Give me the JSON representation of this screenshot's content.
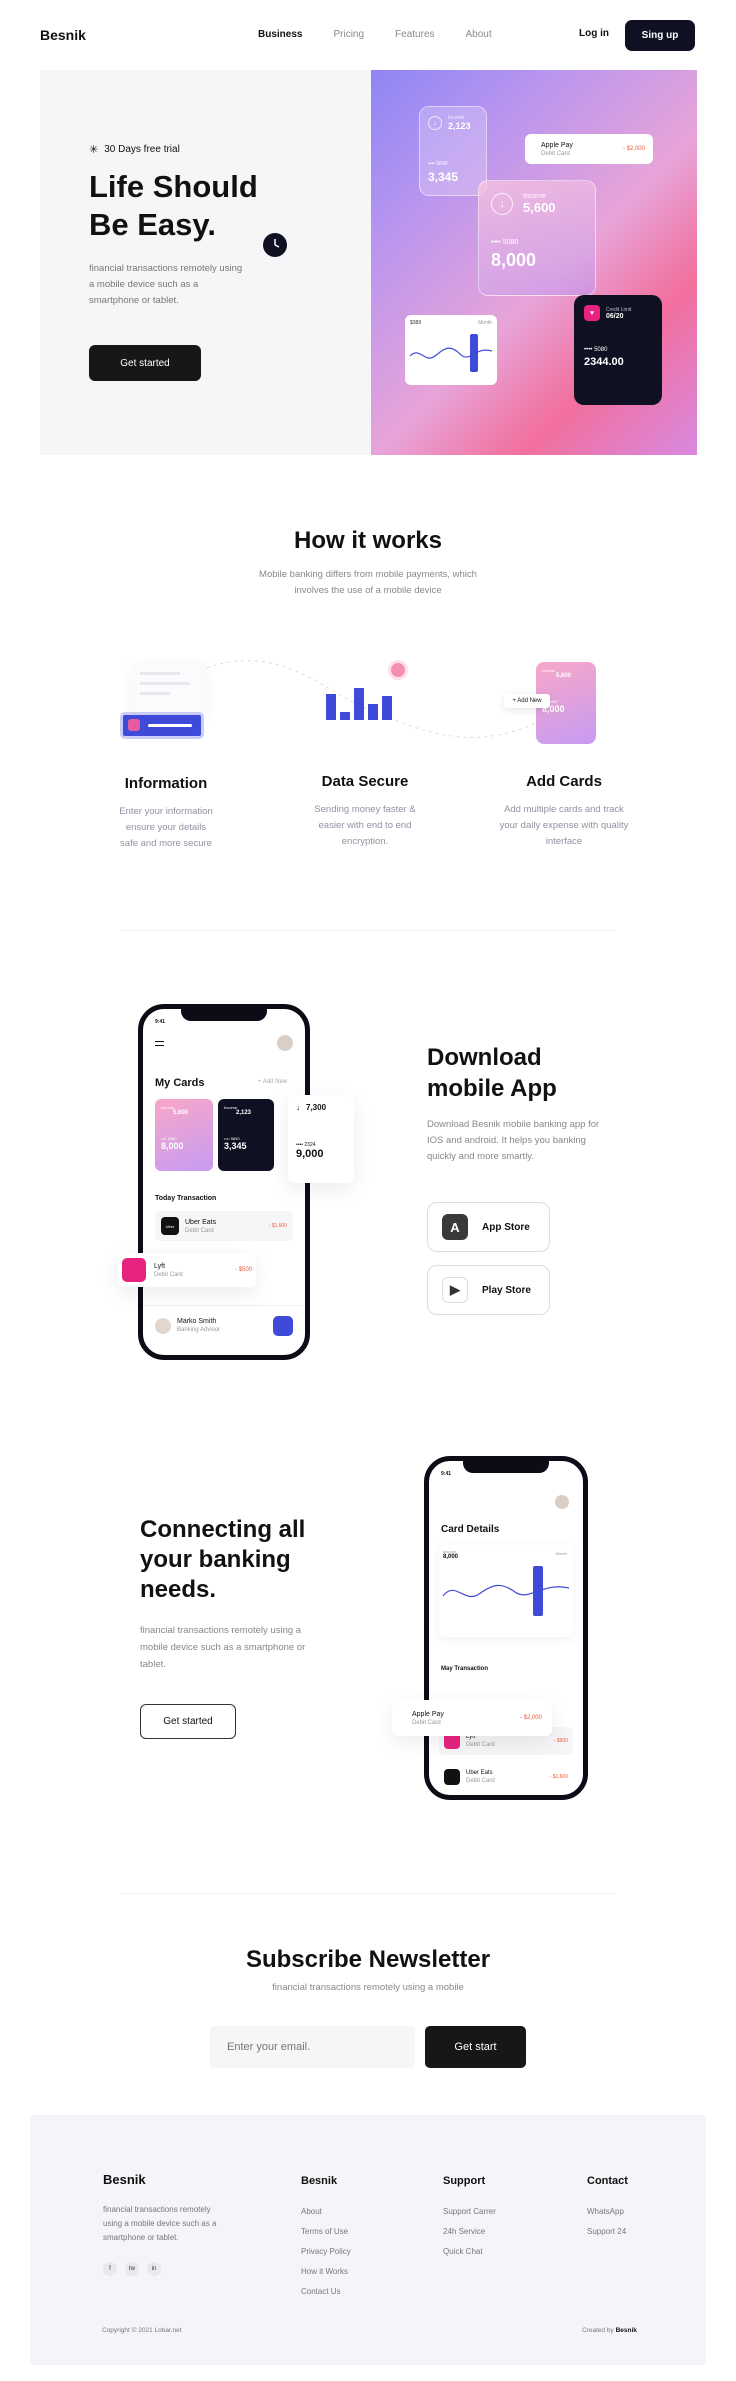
{
  "nav": {
    "logo": "Besnik",
    "links": [
      "Business",
      "Pricing",
      "Features",
      "About"
    ],
    "login": "Log in",
    "signup": "Sing up"
  },
  "hero": {
    "trial": "30 Days free trial",
    "title": "Life Should Be Easy.",
    "text": "financial transactions remotely using a mobile device such as a smartphone or tablet.",
    "cta": "Get started",
    "cards": {
      "income1_label": "Income",
      "income1_value": "2,123",
      "income1_num": "5840",
      "income1_total": "3,345",
      "income2_label": "Income",
      "income2_value": "5,600",
      "income2_num": "5080",
      "income2_total": "8,000",
      "apple_title": "Apple Pay",
      "apple_sub": "Debit Card",
      "apple_amount": "- $2,000",
      "dark_label": "Credit Limit",
      "dark_date": "06/20",
      "dark_num": "5080",
      "dark_total": "2344.00",
      "chart_value": "$389",
      "chart_month": "Month"
    }
  },
  "how": {
    "title": "How it works",
    "subtitle": "Mobile banking differs from mobile payments, which involves the use of a mobile device",
    "features": [
      {
        "title": "Information",
        "text": "Enter your information ensure your details safe and more secure"
      },
      {
        "title": "Data Secure",
        "text": "Sending money faster & easier with end to end encryption."
      },
      {
        "title": "Add Cards",
        "text": "Add multiple cards and  track your daily expense with quality interface"
      }
    ],
    "add_new": "+ Add New",
    "card_income": "Income",
    "card_value": "5,600",
    "card_num": "5080",
    "card_total": "8,000"
  },
  "download": {
    "title": "Download mobile App",
    "text": "Download Besnik mobile banking app for IOS and android. It helps you banking quickly and more smartly.",
    "app_store": "App Store",
    "play_store": "Play Store",
    "phone": {
      "time": "9:41",
      "heading": "My Cards",
      "add": "+ Add New",
      "c1_label": "Income",
      "c1_value": "5,600",
      "c1_num": "5080",
      "c1_total": "8,000",
      "c2_label": "Income",
      "c2_value": "2,123",
      "c2_num": "5840",
      "c2_total": "3,345",
      "c3_value": "7,300",
      "c3_num": "2324",
      "c3_total": "9,000",
      "tx_heading": "Today Transaction",
      "tx1_name": "Uber Eats",
      "tx1_sub": "Debit Card",
      "tx1_amount": "- $1,600",
      "tx2_name": "Lyft",
      "tx2_sub": "Debit Card",
      "tx2_amount": "- $500",
      "contact_name": "Marko Smith",
      "contact_role": "Banking Advisor"
    }
  },
  "connect": {
    "title": "Connecting all your banking needs.",
    "text": "financial transactions remotely using a mobile device such as a smartphone or tablet.",
    "cta": "Get started",
    "phone": {
      "time": "9:41",
      "heading": "Card Details",
      "income_label": "Income",
      "income_value": "8,000",
      "month": "Month",
      "tx_heading": "May Transaction",
      "tx1_name": "Apple Pay",
      "tx1_sub": "Debit Card",
      "tx1_amount": "- $2,000",
      "tx2_name": "Lyft",
      "tx2_sub": "Debit Card",
      "tx2_amount": "- $500",
      "tx3_name": "Uber Eats",
      "tx3_sub": "Debit Card",
      "tx3_amount": "- $1,600"
    }
  },
  "newsletter": {
    "title": "Subscribe Newsletter",
    "subtitle": "financial transactions remotely using a mobile",
    "placeholder": "Enter your email.",
    "button": "Get start"
  },
  "footer": {
    "logo": "Besnik",
    "text": "financial transactions remotely using a mobile device such as a smartphone or tablet.",
    "social": [
      "f",
      "tw",
      "in"
    ],
    "col1": {
      "title": "Besnik",
      "links": [
        "About",
        "Terms of Use",
        "Privacy Policy",
        "How it Works",
        "Contact Us"
      ]
    },
    "col2": {
      "title": "Support",
      "links": [
        "Support Carrer",
        "24h Service",
        "Quick Chat"
      ]
    },
    "col3": {
      "title": "Contact",
      "links": [
        "WhatsApp",
        "Support 24"
      ]
    },
    "copyright": "Copyright © 2021 Lobar.net",
    "credit_prefix": "Created by ",
    "credit_name": "Besnik"
  },
  "colors": {
    "dark": "#0f1021",
    "accent": "#3e4bd8",
    "pink": "#e8237f",
    "red": "#f05a3c"
  }
}
